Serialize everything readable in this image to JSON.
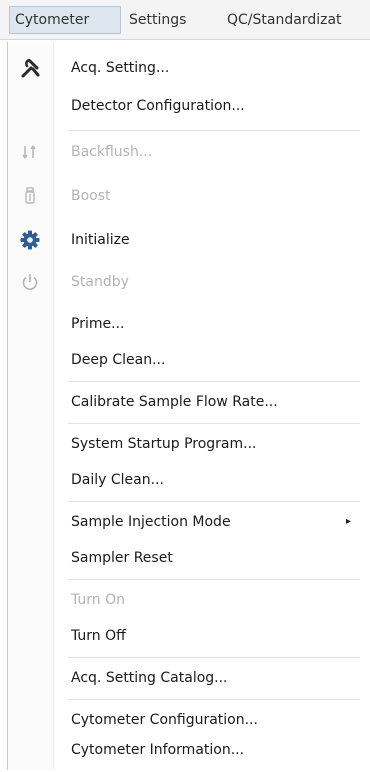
{
  "menubar": {
    "items": [
      {
        "label": "Cytometer"
      },
      {
        "label": "Settings"
      },
      {
        "label": "QC/Standardizat"
      }
    ]
  },
  "menu": {
    "items": [
      {
        "label": "Acq. Setting...",
        "icon": "wrench-icon",
        "enabled": true
      },
      {
        "label": "Detector Configuration...",
        "icon": null,
        "enabled": true
      },
      {
        "label": "Backflush...",
        "icon": "backflush-icon",
        "enabled": false
      },
      {
        "label": "Boost",
        "icon": "boost-icon",
        "enabled": false
      },
      {
        "label": "Initialize",
        "icon": "gear-icon",
        "enabled": true
      },
      {
        "label": "Standby",
        "icon": "power-icon",
        "enabled": false
      },
      {
        "label": "Prime...",
        "icon": null,
        "enabled": true
      },
      {
        "label": "Deep Clean...",
        "icon": null,
        "enabled": true
      },
      {
        "label": "Calibrate Sample Flow Rate...",
        "icon": null,
        "enabled": true
      },
      {
        "label": "System Startup Program...",
        "icon": null,
        "enabled": true
      },
      {
        "label": "Daily Clean...",
        "icon": null,
        "enabled": true
      },
      {
        "label": "Sample Injection Mode",
        "icon": null,
        "enabled": true,
        "submenu_arrow": "▸"
      },
      {
        "label": "Sampler Reset",
        "icon": null,
        "enabled": true
      },
      {
        "label": "Turn On",
        "icon": null,
        "enabled": false
      },
      {
        "label": "Turn Off",
        "icon": null,
        "enabled": true
      },
      {
        "label": "Acq. Setting Catalog...",
        "icon": null,
        "enabled": true
      },
      {
        "label": "Cytometer Configuration...",
        "icon": null,
        "enabled": true
      },
      {
        "label": "Cytometer Information...",
        "icon": null,
        "enabled": true
      }
    ]
  }
}
